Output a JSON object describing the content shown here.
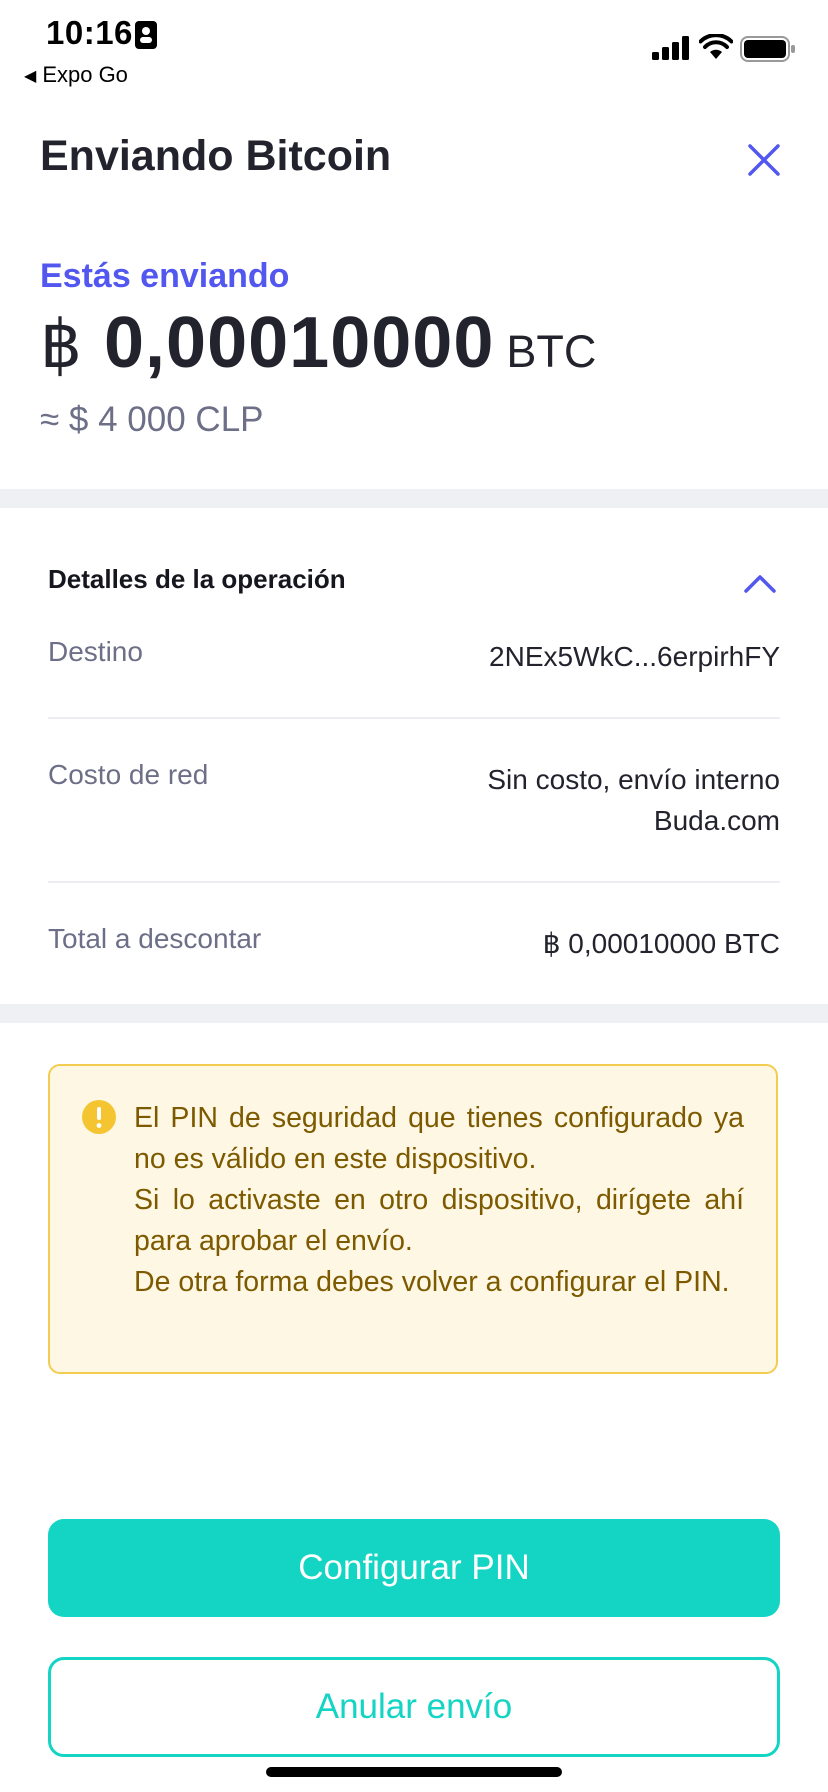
{
  "status_bar": {
    "time": "10:16",
    "back_app_label": "Expo Go",
    "icons": [
      "person-badge-icon",
      "signal-icon",
      "wifi-icon",
      "battery-icon"
    ]
  },
  "header": {
    "title": "Enviando Bitcoin",
    "close_icon": "close-icon"
  },
  "amount": {
    "label": "Estás enviando",
    "symbol": "฿",
    "value": "0,00010000",
    "unit": "BTC",
    "approx_clp": "≈ $ 4 000 CLP"
  },
  "details": {
    "title": "Detalles de la operación",
    "toggle_icon": "chevron-up-icon",
    "rows": [
      {
        "label": "Destino",
        "value_lines": [
          "2NEx5WkC...6erpirhFY"
        ]
      },
      {
        "label": "Costo de red",
        "value_lines": [
          "Sin costo, envío interno",
          "Buda.com"
        ]
      },
      {
        "label": "Total a descontar",
        "value_lines": [
          "฿ 0,00010000 BTC"
        ]
      }
    ]
  },
  "warning": {
    "icon": "exclamation-icon",
    "paragraphs": [
      "El PIN de seguridad que tienes configurado ya no es válido en este dispositivo.",
      "Si lo activaste en otro dispositivo, dirígete ahí para aprobar el envío.",
      "De otra forma debes volver a configurar el PIN."
    ]
  },
  "actions": {
    "primary_label": "Configurar PIN",
    "secondary_label": "Anular envío"
  },
  "colors": {
    "accent_blue": "#5257f0",
    "teal": "#14d4c4",
    "warning_border": "#f2cd4f",
    "warning_bg": "#fef7e4",
    "warning_text": "#7d5a00",
    "band": "#eff0f4"
  }
}
